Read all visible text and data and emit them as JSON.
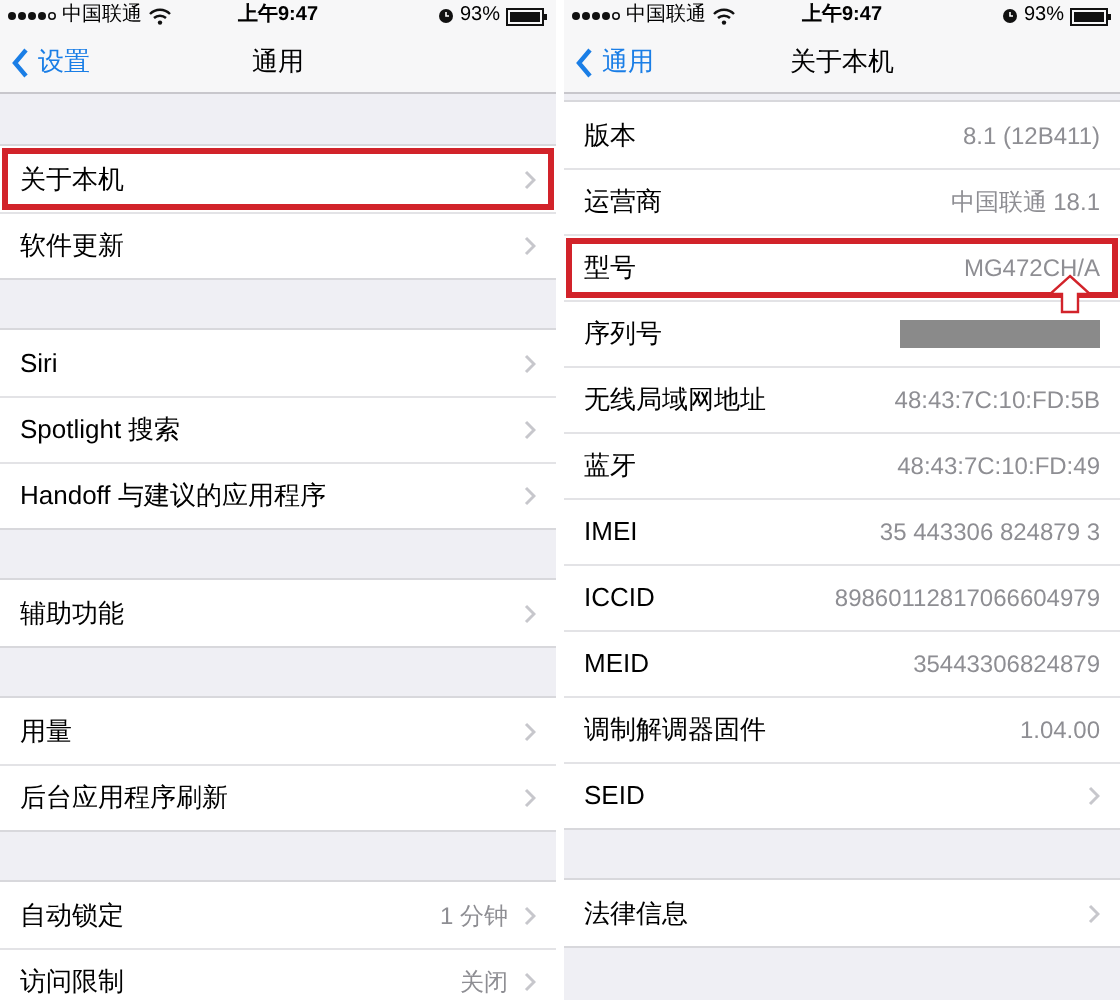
{
  "panels": [
    {
      "status_bar": {
        "carrier": "中国联通",
        "time": "上午9:47",
        "battery": "93%"
      },
      "nav": {
        "back": "设置",
        "title": "通用"
      },
      "groups": [
        {
          "rows": [
            {
              "label": "关于本机",
              "chevron": true,
              "highlighted": true
            },
            {
              "label": "软件更新",
              "chevron": true,
              "highlighted": false
            }
          ]
        },
        {
          "rows": [
            {
              "label": "Siri",
              "chevron": true,
              "highlighted": false
            },
            {
              "label": "Spotlight 搜索",
              "chevron": true,
              "highlighted": false
            },
            {
              "label": "Handoff 与建议的应用程序",
              "chevron": true,
              "highlighted": false
            }
          ]
        },
        {
          "rows": [
            {
              "label": "辅助功能",
              "chevron": true,
              "highlighted": false
            }
          ]
        },
        {
          "rows": [
            {
              "label": "用量",
              "chevron": true,
              "highlighted": false
            },
            {
              "label": "后台应用程序刷新",
              "chevron": true,
              "highlighted": false
            }
          ]
        },
        {
          "rows": [
            {
              "label": "自动锁定",
              "value": "1 分钟",
              "chevron": true,
              "highlighted": false
            },
            {
              "label": "访问限制",
              "value": "关闭",
              "chevron": true,
              "highlighted": false
            }
          ]
        }
      ]
    },
    {
      "status_bar": {
        "carrier": "中国联通",
        "time": "上午9:47",
        "battery": "93%"
      },
      "nav": {
        "back": "通用",
        "title": "关于本机"
      },
      "groups": [
        {
          "rows": [
            {
              "label": "版本",
              "value": "8.1 (12B411)",
              "chevron": false,
              "highlighted": false
            },
            {
              "label": "运营商",
              "value": "中国联通 18.1",
              "chevron": false,
              "highlighted": false
            },
            {
              "label": "型号",
              "value": "MG472CH/A",
              "chevron": false,
              "highlighted": true,
              "annotation_arrow": true
            },
            {
              "label": "序列号",
              "redacted": true,
              "chevron": false,
              "highlighted": false
            },
            {
              "label": "无线局域网地址",
              "value": "48:43:7C:10:FD:5B",
              "chevron": false,
              "highlighted": false
            },
            {
              "label": "蓝牙",
              "value": "48:43:7C:10:FD:49",
              "chevron": false,
              "highlighted": false
            },
            {
              "label": "IMEI",
              "value": "35 443306 824879 3",
              "chevron": false,
              "highlighted": false
            },
            {
              "label": "ICCID",
              "value": "89860112817066604979",
              "chevron": false,
              "highlighted": false
            },
            {
              "label": "MEID",
              "value": "35443306824879",
              "chevron": false,
              "highlighted": false
            },
            {
              "label": "调制解调器固件",
              "value": "1.04.00",
              "chevron": false,
              "highlighted": false
            },
            {
              "label": "SEID",
              "chevron": true,
              "highlighted": false
            }
          ]
        },
        {
          "rows": [
            {
              "label": "法律信息",
              "chevron": true,
              "highlighted": false
            }
          ]
        }
      ]
    }
  ]
}
